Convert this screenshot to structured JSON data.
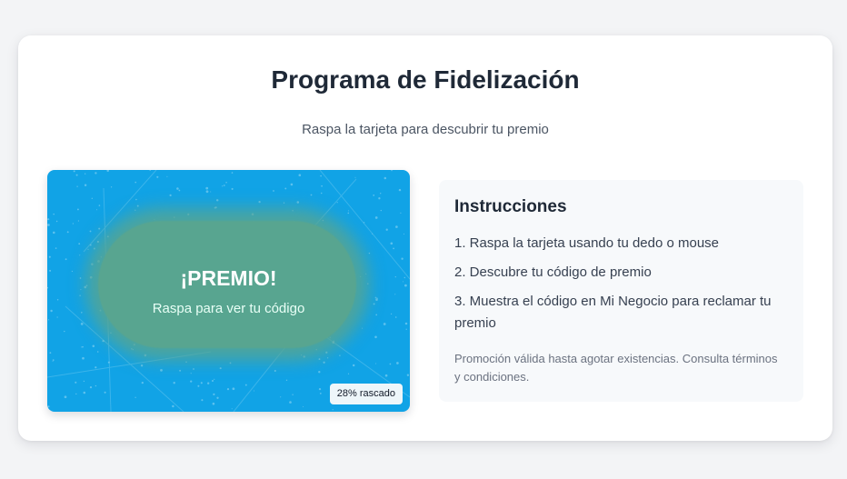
{
  "header": {
    "title": "Programa de Fidelización",
    "subtitle": "Raspa la tarjeta para descubrir tu premio"
  },
  "scratch_card": {
    "prize_title": "¡PREMIO!",
    "prize_hint": "Raspa para ver tu código",
    "progress_label": "28% rascado",
    "progress_fraction": 0.28,
    "colors": {
      "surface": "#11a3e6",
      "revealed": "#58a590"
    }
  },
  "instructions": {
    "title": "Instrucciones",
    "steps": [
      "1. Raspa la tarjeta usando tu dedo o mouse",
      "2. Descubre tu código de premio",
      "3. Muestra el código en Mi Negocio para reclamar tu premio"
    ],
    "note": "Promoción válida hasta agotar existencias. Consulta términos y condiciones."
  }
}
